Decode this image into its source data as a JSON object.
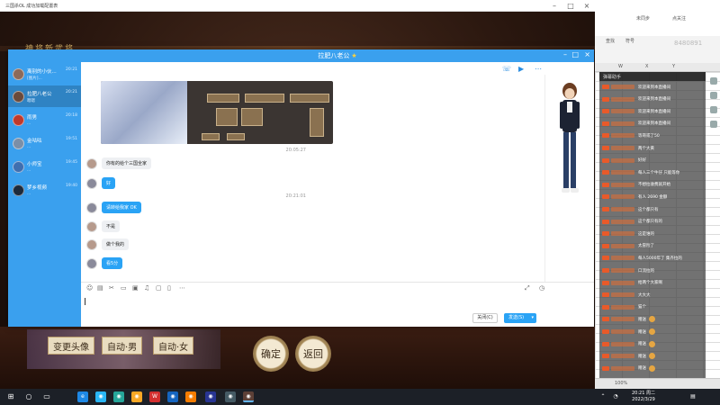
{
  "game_window": {
    "title": "三国杀OL 成功加载配置表",
    "banner": "神将新武将",
    "chips": [
      "变更头像",
      "自动·男",
      "自动·女"
    ],
    "buttons": [
      "确定",
      "返回"
    ]
  },
  "chat": {
    "title": "拉肥八老公",
    "contacts": [
      {
        "name": "离别的小伙...",
        "preview": "[图片]...",
        "time": "20:21",
        "avatar_color": "#8c6a5a",
        "active": false
      },
      {
        "name": "拉肥八老公",
        "preview": "嗯嗯",
        "time": "20:21",
        "avatar_color": "#6a4a3c",
        "active": true
      },
      {
        "name": "雨男",
        "preview": "...",
        "time": "20:18",
        "avatar_color": "#c0392b",
        "active": false
      },
      {
        "name": "金咕咕",
        "preview": "...",
        "time": "19:51",
        "avatar_color": "#7b8fa8",
        "active": false
      },
      {
        "name": "小师宝",
        "preview": "...",
        "time": "19:45",
        "avatar_color": "#3f6fb0",
        "active": false
      },
      {
        "name": "梦乡视频",
        "preview": "...",
        "time": "19:40",
        "avatar_color": "#1c2a3c",
        "active": false
      }
    ],
    "timestamps": [
      "20:05:27",
      "20:21:01"
    ],
    "messages": [
      {
        "text": "你有的给个三国全家",
        "style": "grey"
      },
      {
        "text": "好",
        "style": "blue"
      },
      {
        "text": "请转给我家 OK",
        "style": "blue"
      },
      {
        "text": "不是",
        "style": "grey"
      },
      {
        "text": "做个我的",
        "style": "grey"
      },
      {
        "text": "看5分",
        "style": "blue"
      }
    ],
    "close_label": "关闭(C)",
    "send_label": "发送(S)"
  },
  "right_panel": {
    "top_labels": [
      "未同步",
      "查找",
      "符号",
      "点关注"
    ],
    "big_number": "8480891",
    "columns": [
      "W",
      "X",
      "Y"
    ],
    "danmu_header": "弹幕助手",
    "danmu": [
      "欢迎来到本直播间",
      "欢迎来到本直播间",
      "欢迎来到本直播间",
      "欢迎来到本直播间",
      "等哥或了50",
      "两个大黄",
      "好好",
      "每人三个牛仔 只能等你",
      "不想拉收费就开始",
      "有人 2690 金额",
      "这个都只有",
      "这个都只有的",
      "这是谁的",
      "太冒险了",
      "每人5000年了 集齐拉的",
      "口流拉的",
      "给两个大家啊",
      "大大大",
      "猫个",
      "赠送",
      "赠送",
      "赠送",
      "赠送",
      "赠送"
    ],
    "status_zoom": "100%"
  },
  "taskbar": {
    "time": "20:21 周二",
    "date": "2022/3/29"
  }
}
